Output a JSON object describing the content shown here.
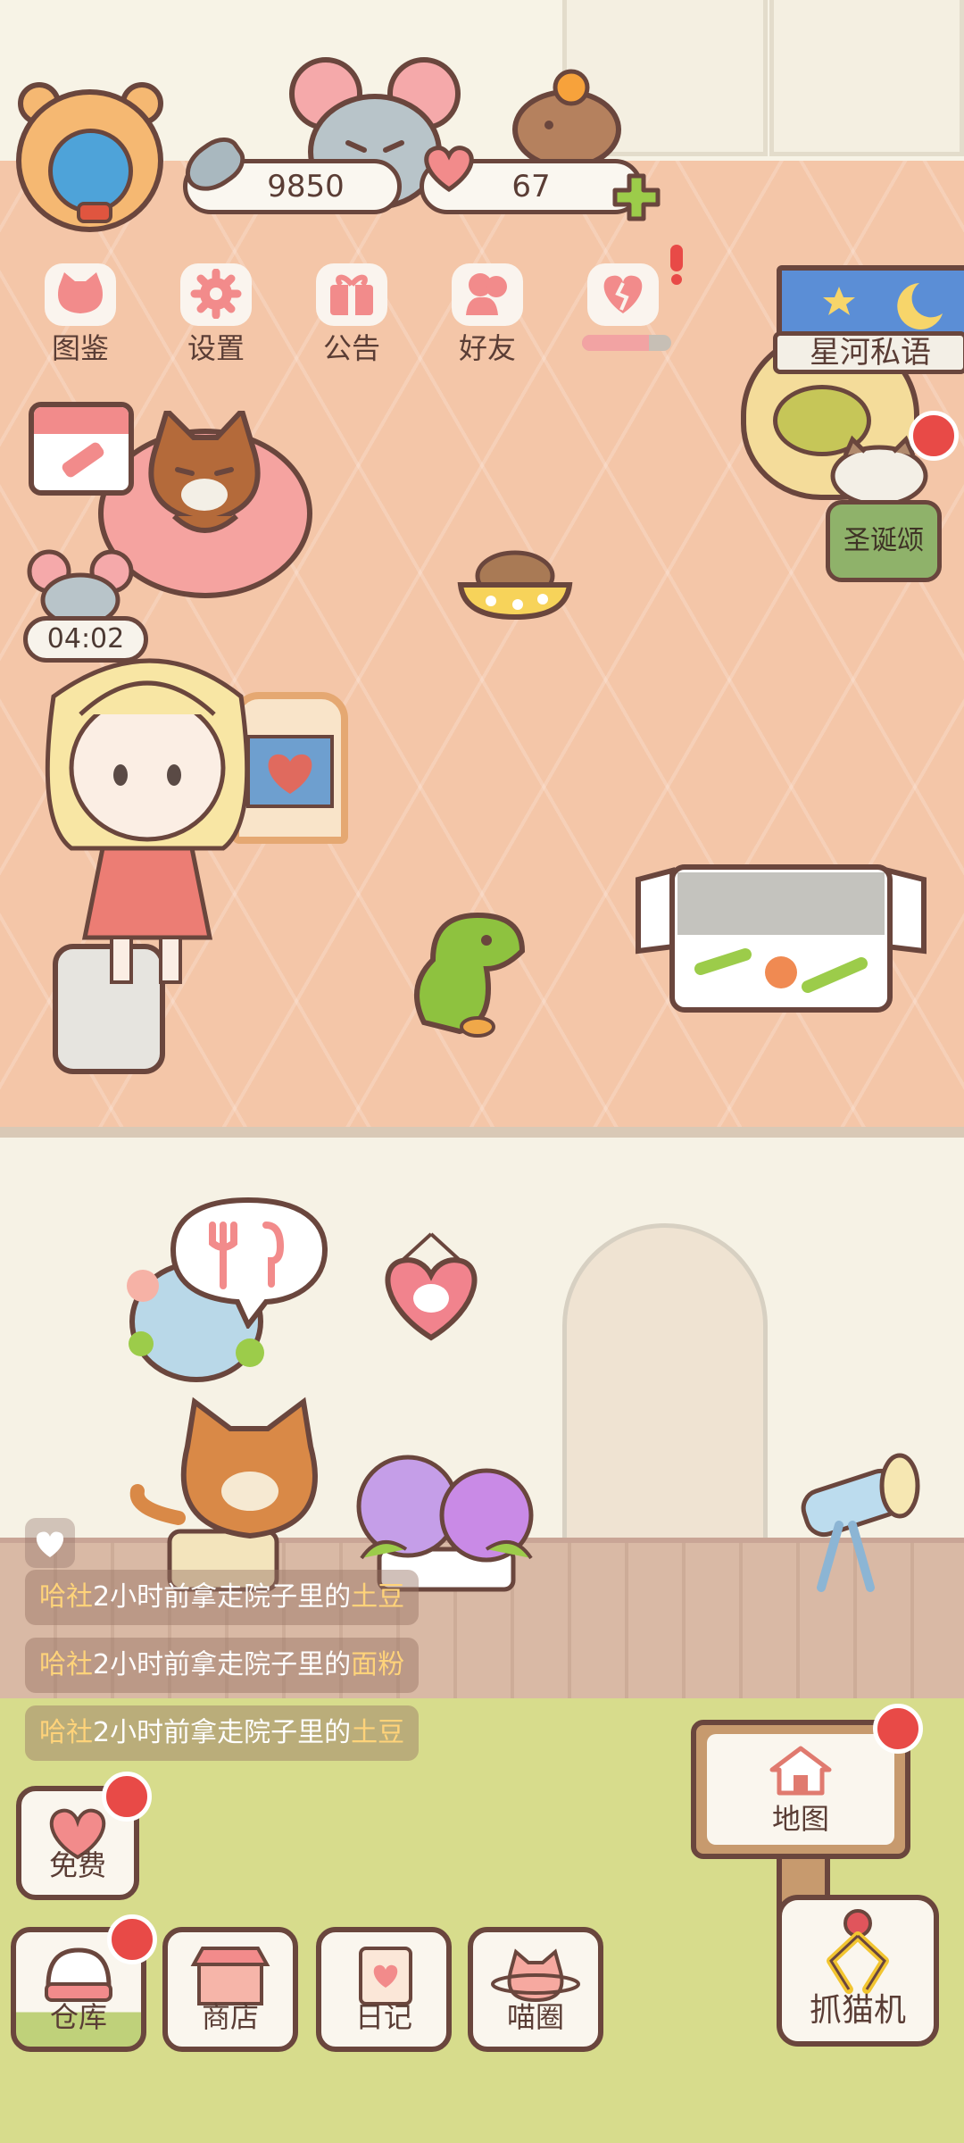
{
  "hud": {
    "fish_count": "9850",
    "heart_count": "67"
  },
  "menu": {
    "items": [
      {
        "label": "图鉴",
        "icon": "cat-head-icon"
      },
      {
        "label": "设置",
        "icon": "gear-icon"
      },
      {
        "label": "公告",
        "icon": "gift-icon"
      },
      {
        "label": "好友",
        "icon": "friends-icon"
      },
      {
        "label": "",
        "icon": "heart-broken-icon"
      }
    ],
    "heart_progress": 0.75
  },
  "signs": {
    "galaxy": "星河私语",
    "christmas": "圣诞颂"
  },
  "timer": "04:02",
  "feed_log": {
    "entries": [
      {
        "who": "哈社",
        "text": "2小时前拿走院子里的",
        "item": "土豆"
      },
      {
        "who": "哈社",
        "text": "2小时前拿走院子里的",
        "item": "面粉"
      },
      {
        "who": "哈社",
        "text": "2小时前拿走院子里的",
        "item": "土豆"
      }
    ]
  },
  "bottom": {
    "free": "免费",
    "warehouse": "仓库",
    "shop": "商店",
    "diary": "日记",
    "cat_circle": "喵圈",
    "map": "地图",
    "claw_machine": "抓猫机"
  },
  "colors": {
    "outline": "#6a463d",
    "badge_red": "#e84a47",
    "floor": "#f4c6a8",
    "grass": "#d7dc8c",
    "accent_pink": "#f28b8b",
    "highlight_text": "#ffd37a"
  }
}
